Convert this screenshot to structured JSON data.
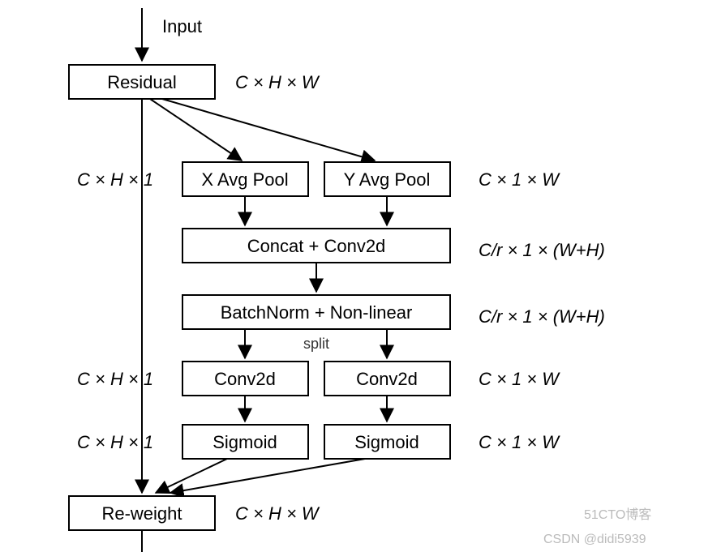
{
  "labels": {
    "input": "Input",
    "residual": "Residual",
    "xavg": "X Avg Pool",
    "yavg": "Y Avg Pool",
    "concat": "Concat + Conv2d",
    "bn": "BatchNorm + Non-linear",
    "split": "split",
    "conv_l": "Conv2d",
    "conv_r": "Conv2d",
    "sig_l": "Sigmoid",
    "sig_r": "Sigmoid",
    "reweight": "Re-weight"
  },
  "dims": {
    "residual": "C × H × W",
    "left1": "C × H × 1",
    "right1": "C × 1 × W",
    "concat": "C/r × 1 × (W+H)",
    "bn": "C/r × 1 × (W+H)",
    "left_conv": "C × H × 1",
    "right_conv": "C × 1 × W",
    "left_sig": "C × H × 1",
    "right_sig": "C × 1 × W",
    "reweight": "C × H × W"
  },
  "footer": {
    "csdn": "CSDN @didi5939",
    "wm": "51CTO博客"
  }
}
